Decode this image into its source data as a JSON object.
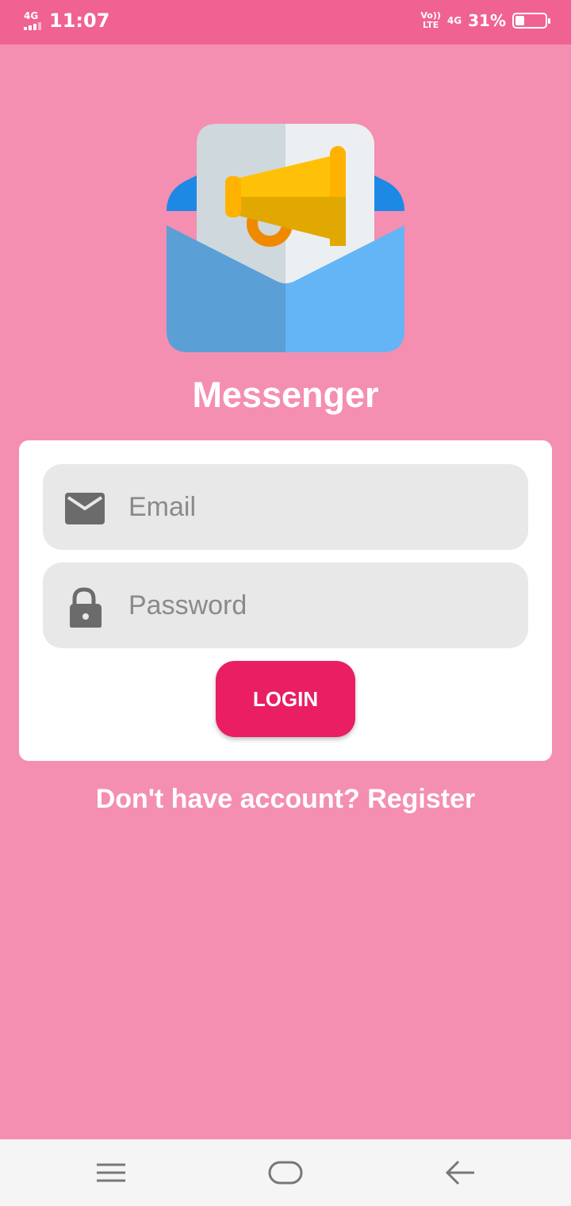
{
  "status_bar": {
    "network_left": "4G",
    "time": "11:07",
    "volte_top": "Vo))",
    "volte_bottom": "LTE",
    "network_right": "4G",
    "battery_percent": "31%",
    "battery_level": 0.31,
    "signal_icon": "signal-bars-icon",
    "battery_icon": "battery-icon"
  },
  "app": {
    "title": "Messenger",
    "logo_icon": "envelope-megaphone-icon"
  },
  "login_form": {
    "email": {
      "placeholder": "Email",
      "value": "",
      "icon": "mail-icon"
    },
    "password": {
      "placeholder": "Password",
      "value": "",
      "icon": "lock-icon"
    },
    "login_label": "LOGIN"
  },
  "register_text": "Don't have account? Register",
  "nav_bar": {
    "menu_icon": "menu-icon",
    "home_icon": "home-icon",
    "back_icon": "back-arrow-icon"
  },
  "colors": {
    "background": "#f48fb1",
    "status_bar": "#f06292",
    "accent": "#e91e63",
    "card": "#ffffff",
    "field": "#e8e8e8"
  }
}
